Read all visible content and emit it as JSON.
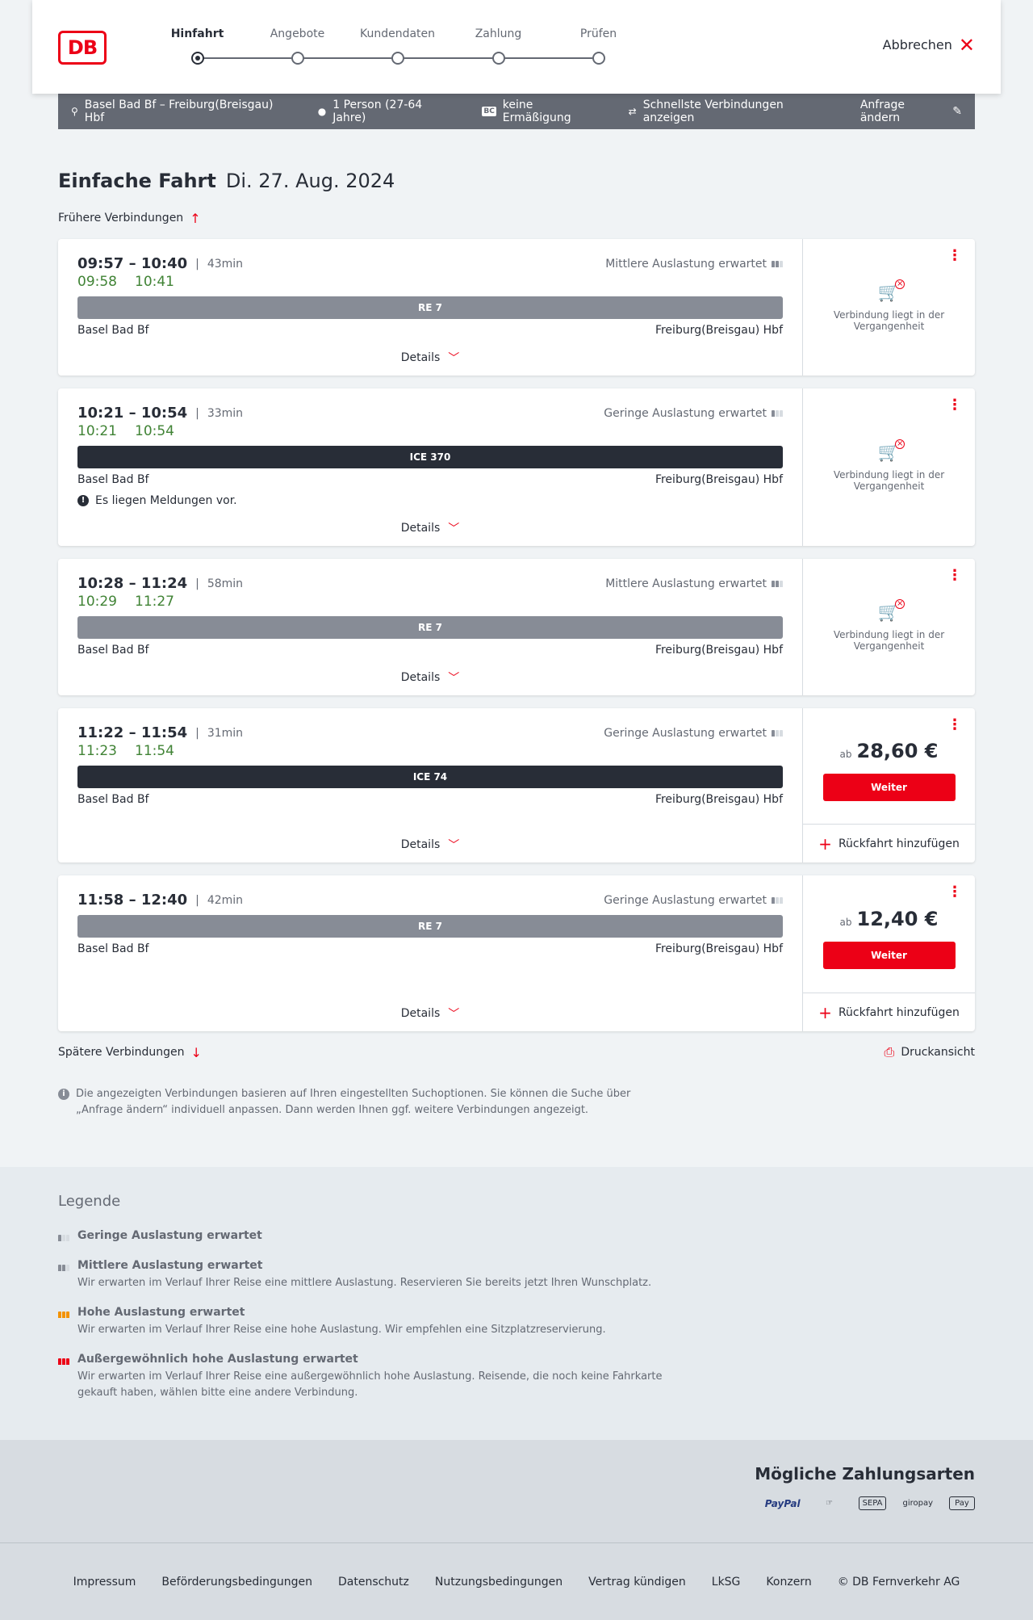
{
  "header": {
    "logo": "DB",
    "steps": [
      {
        "label": "Hinfahrt",
        "active": true
      },
      {
        "label": "Angebote",
        "active": false
      },
      {
        "label": "Kundendaten",
        "active": false
      },
      {
        "label": "Zahlung",
        "active": false
      },
      {
        "label": "Prüfen",
        "active": false
      }
    ],
    "cancel_label": "Abbrechen"
  },
  "summary": {
    "route": "Basel Bad Bf – Freiburg(Breisgau) Hbf",
    "passengers": "1 Person (27-64 Jahre)",
    "bc_badge": "BC",
    "discount": "keine Ermäßigung",
    "option": "Schnellste Verbindungen anzeigen",
    "edit_label": "Anfrage ändern"
  },
  "trip": {
    "type": "Einfache Fahrt",
    "date": "Di. 27. Aug. 2024",
    "earlier_label": "Frühere Verbindungen",
    "later_label": "Spätere Verbindungen",
    "print_label": "Druckansicht"
  },
  "connections": [
    {
      "dep": "09:57",
      "arr": "10:40",
      "range": "09:57 – 10:40",
      "duration": "43min",
      "rt_dep": "09:58",
      "rt_arr": "10:41",
      "load": "Mittlere Auslastung erwartet",
      "train": "RE 7",
      "train_type": "re",
      "from": "Basel Bad Bf",
      "to": "Freiburg(Breisgau) Hbf",
      "notice": "",
      "details": "Details",
      "past": "Verbindung liegt in der Vergangenheit",
      "price": "",
      "price_prefix": "",
      "book": "",
      "return": ""
    },
    {
      "dep": "10:21",
      "arr": "10:54",
      "range": "10:21 – 10:54",
      "duration": "33min",
      "rt_dep": "10:21",
      "rt_arr": "10:54",
      "load": "Geringe Auslastung erwartet",
      "train": "ICE 370",
      "train_type": "ice",
      "from": "Basel Bad Bf",
      "to": "Freiburg(Breisgau) Hbf",
      "notice": "Es liegen Meldungen vor.",
      "details": "Details",
      "past": "Verbindung liegt in der Vergangenheit",
      "price": "",
      "price_prefix": "",
      "book": "",
      "return": ""
    },
    {
      "dep": "10:28",
      "arr": "11:24",
      "range": "10:28 – 11:24",
      "duration": "58min",
      "rt_dep": "10:29",
      "rt_arr": "11:27",
      "load": "Mittlere Auslastung erwartet",
      "train": "RE 7",
      "train_type": "re",
      "from": "Basel Bad Bf",
      "to": "Freiburg(Breisgau) Hbf",
      "notice": "",
      "details": "Details",
      "past": "Verbindung liegt in der Vergangenheit",
      "price": "",
      "price_prefix": "",
      "book": "",
      "return": ""
    },
    {
      "dep": "11:22",
      "arr": "11:54",
      "range": "11:22 – 11:54",
      "duration": "31min",
      "rt_dep": "11:23",
      "rt_arr": "11:54",
      "load": "Geringe Auslastung erwartet",
      "train": "ICE 74",
      "train_type": "ice",
      "from": "Basel Bad Bf",
      "to": "Freiburg(Breisgau) Hbf",
      "notice": "",
      "details": "Details",
      "past": "",
      "price": "28,60 €",
      "price_prefix": "ab",
      "book": "Weiter",
      "return": "Rückfahrt hinzufügen"
    },
    {
      "dep": "11:58",
      "arr": "12:40",
      "range": "11:58 – 12:40",
      "duration": "42min",
      "rt_dep": "",
      "rt_arr": "",
      "load": "Geringe Auslastung erwartet",
      "train": "RE 7",
      "train_type": "re",
      "from": "Basel Bad Bf",
      "to": "Freiburg(Breisgau) Hbf",
      "notice": "",
      "details": "Details",
      "past": "",
      "price": "12,40 €",
      "price_prefix": "ab",
      "book": "Weiter",
      "return": "Rückfahrt hinzufügen"
    }
  ],
  "info_text": "Die angezeigten Verbindungen basieren auf Ihren eingestellten Suchoptionen. Sie können die Suche über „Anfrage ändern“ individuell anpassen. Dann werden Ihnen ggf. weitere Verbindungen angezeigt.",
  "legend": {
    "title": "Legende",
    "items": [
      {
        "title": "Geringe Auslastung erwartet",
        "desc": "",
        "level": "low"
      },
      {
        "title": "Mittlere Auslastung erwartet",
        "desc": "Wir erwarten im Verlauf Ihrer Reise eine mittlere Auslastung. Reservieren Sie bereits jetzt Ihren Wunschplatz.",
        "level": "mid"
      },
      {
        "title": "Hohe Auslastung erwartet",
        "desc": "Wir erwarten im Verlauf Ihrer Reise eine hohe Auslastung. Wir empfehlen eine Sitzplatzreservierung.",
        "level": "high"
      },
      {
        "title": "Außergewöhnlich hohe Auslastung erwartet",
        "desc": "Wir erwarten im Verlauf Ihrer Reise eine außergewöhnlich hohe Auslastung. Reisende, die noch keine Fahrkarte gekauft haben, wählen bitte eine andere Verbindung.",
        "level": "vhigh"
      }
    ]
  },
  "payment": {
    "title": "Mögliche Zahlungsarten",
    "methods": [
      "PayPal",
      "SEPA",
      "giropay",
      "Pay"
    ]
  },
  "footer": {
    "links": [
      "Impressum",
      "Beförderungsbedingungen",
      "Datenschutz",
      "Nutzungsbedingungen",
      "Vertrag kündigen",
      "LkSG",
      "Konzern",
      "© DB Fernverkehr AG"
    ]
  },
  "colors": {
    "brand": "#ec0016",
    "realtime": "#408335",
    "ice_bar": "#282d37",
    "re_bar": "#878c96"
  }
}
